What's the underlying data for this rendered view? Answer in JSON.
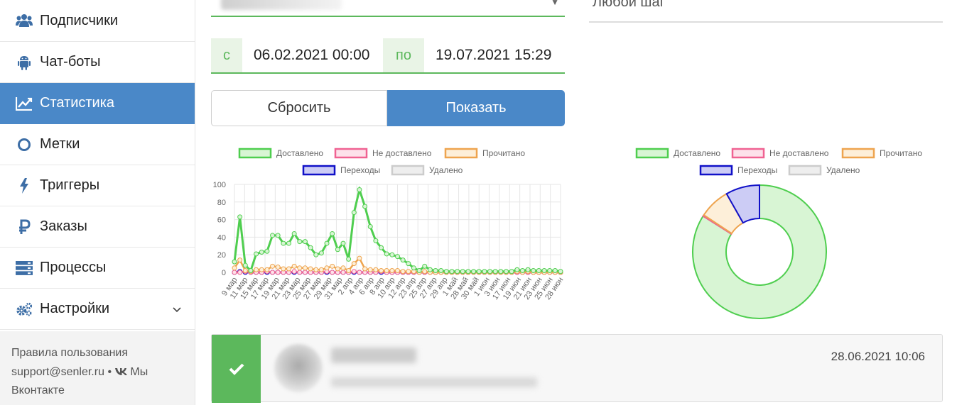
{
  "sidebar": {
    "items": [
      {
        "label": "Подписчики",
        "icon": "users-icon"
      },
      {
        "label": "Чат-боты",
        "icon": "android-icon"
      },
      {
        "label": "Статистика",
        "icon": "line-chart-icon",
        "active": true
      },
      {
        "label": "Метки",
        "icon": "circle-icon"
      },
      {
        "label": "Триггеры",
        "icon": "bolt-icon"
      },
      {
        "label": "Заказы",
        "icon": "ruble-icon"
      },
      {
        "label": "Процессы",
        "icon": "server-icon"
      },
      {
        "label": "Настройки",
        "icon": "cogs-icon",
        "has_dropdown": true
      }
    ],
    "footer": {
      "rules": "Правила пользования",
      "email": "support@senler.ru",
      "separator": "•",
      "vk": "Мы",
      "vk_line2": "Вконтакте"
    }
  },
  "filters": {
    "step_value": "Любой шаг",
    "date_from_label": "с",
    "date_from": "06.02.2021 00:00",
    "date_to_label": "по",
    "date_to": "19.07.2021 15:29",
    "reset_label": "Сбросить",
    "show_label": "Показать"
  },
  "colors": {
    "accent": "#4a88c8",
    "success": "#5cb85c",
    "delivered": "#4fce4f",
    "not_delivered": "#f06292",
    "read": "#eea44f",
    "clicks": "#1010c8",
    "deleted": "#cccccc"
  },
  "chart_data": [
    {
      "type": "line",
      "legend": [
        "Доставлено",
        "Не доставлено",
        "Прочитано",
        "Переходы",
        "Удалено"
      ],
      "ylim": [
        0,
        100
      ],
      "yticks": [
        "100",
        "80",
        "60",
        "40",
        "20",
        "0"
      ],
      "xtick_labels": [
        "9 мар",
        "11 мар",
        "15 мар",
        "17 мар",
        "19 мар",
        "21 мар",
        "23 мар",
        "25 мар",
        "27 мар",
        "29 мар",
        "31 мар",
        "2 апр",
        "4 апр",
        "6 апр",
        "8 апр",
        "10 апр",
        "12 апр",
        "23 апр",
        "25 апр",
        "27 апр",
        "29 апр",
        "1 май",
        "28 май",
        "30 май",
        "1 июн",
        "3 июн",
        "17 июн",
        "19 июн",
        "21 июн",
        "23 июн",
        "25 июн",
        "28 июн"
      ],
      "series": [
        {
          "name": "Доставлено",
          "values": [
            12,
            63,
            8,
            2,
            21,
            23,
            24,
            42,
            42,
            33,
            33,
            44,
            35,
            35,
            28,
            20,
            22,
            33,
            44,
            26,
            33,
            15,
            68,
            94,
            75,
            52,
            36,
            28,
            21,
            20,
            18,
            14,
            10,
            5,
            2,
            7,
            3,
            2,
            2,
            1,
            1,
            1,
            1,
            1,
            1,
            1,
            1,
            1,
            1,
            1,
            1,
            1,
            3,
            2,
            3,
            2,
            2,
            2,
            2,
            2,
            1
          ]
        },
        {
          "name": "Не доставлено",
          "values": [
            0,
            0,
            1,
            0,
            0,
            0,
            1,
            0,
            0,
            0,
            0,
            1,
            0,
            0,
            0,
            0,
            0,
            1,
            0,
            0,
            0,
            0,
            1,
            0,
            0,
            0,
            0,
            1,
            0,
            0,
            0,
            0,
            0,
            0,
            0,
            0,
            0,
            0,
            0,
            0,
            0,
            0,
            0,
            0,
            0,
            0,
            0,
            0,
            0,
            0,
            0,
            0,
            0,
            0,
            0,
            0,
            0,
            0,
            0,
            0,
            0
          ]
        },
        {
          "name": "Прочитано",
          "values": [
            5,
            14,
            2,
            1,
            3,
            3,
            3,
            7,
            6,
            4,
            4,
            7,
            5,
            5,
            4,
            3,
            3,
            5,
            7,
            4,
            5,
            2,
            10,
            16,
            4,
            3,
            3,
            2,
            2,
            2,
            2,
            1,
            1,
            1,
            0,
            1,
            0,
            0,
            0,
            0,
            0,
            0,
            0,
            0,
            0,
            0,
            0,
            0,
            0,
            0,
            0,
            0,
            1,
            0,
            1,
            0,
            0,
            0,
            0,
            0,
            0
          ]
        },
        {
          "name": "Переходы",
          "values": [
            0,
            1,
            0,
            0,
            0,
            0,
            0,
            0,
            0,
            0,
            0,
            0,
            0,
            0,
            0,
            0,
            0,
            0,
            0,
            0,
            0,
            0,
            0,
            0,
            0,
            0,
            0,
            0,
            0,
            0,
            0,
            0,
            0,
            0,
            0,
            0,
            0,
            0,
            0,
            0,
            0,
            0,
            0,
            0,
            0,
            0,
            0,
            0,
            0,
            0,
            0,
            0,
            0,
            0,
            0,
            0,
            0,
            0,
            0,
            0,
            0
          ]
        },
        {
          "name": "Удалено",
          "values": [
            0,
            0,
            0,
            0,
            0,
            0,
            0,
            0,
            0,
            0,
            0,
            0,
            0,
            0,
            0,
            0,
            0,
            0,
            0,
            0,
            0,
            0,
            0,
            0,
            0,
            0,
            0,
            0,
            0,
            0,
            0,
            0,
            0,
            0,
            0,
            0,
            0,
            0,
            0,
            0,
            0,
            0,
            0,
            0,
            0,
            0,
            0,
            0,
            0,
            0,
            0,
            0,
            0,
            0,
            0,
            0,
            0,
            0,
            0,
            0,
            0
          ]
        }
      ]
    },
    {
      "type": "pie",
      "style": "doughnut",
      "legend": [
        "Доставлено",
        "Не доставлено",
        "Прочитано",
        "Переходы",
        "Удалено"
      ],
      "values": [
        84,
        0.3,
        7.5,
        8.2,
        0
      ]
    }
  ],
  "message": {
    "check_icon": "check-icon",
    "date": "28.06.2021 10:06"
  }
}
